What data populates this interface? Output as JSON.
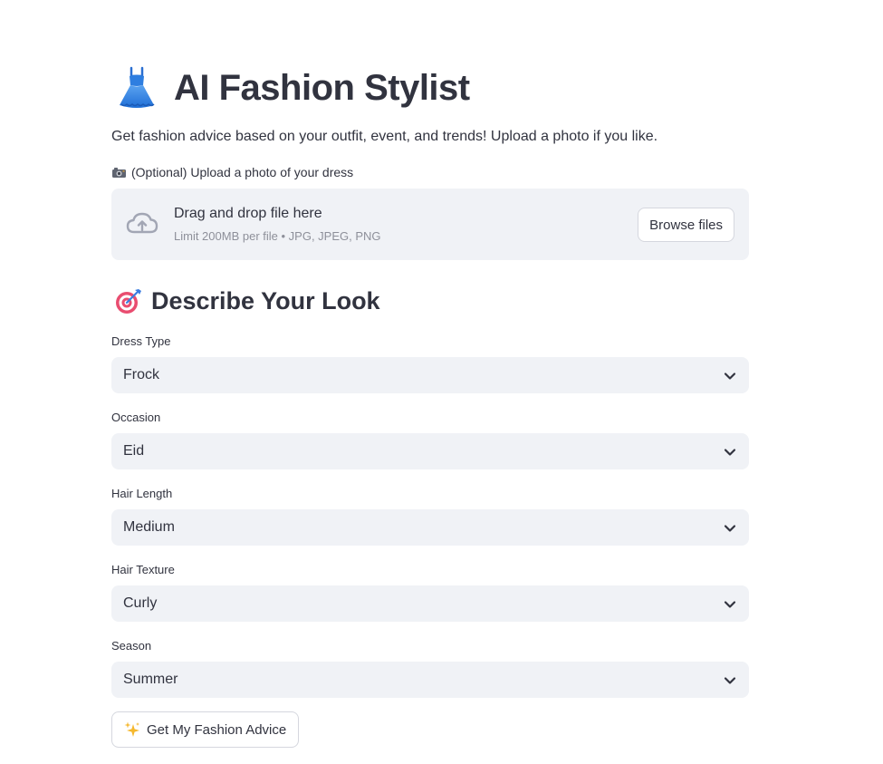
{
  "header": {
    "title": "AI Fashion Stylist",
    "title_icon": "dress-icon",
    "subtitle": "Get fashion advice based on your outfit, event, and trends! Upload a photo if you like."
  },
  "upload": {
    "label_icon": "camera-icon",
    "label": "(Optional) Upload a photo of your dress",
    "drop_text": "Drag and drop file here",
    "limit_text": "Limit 200MB per file • JPG, JPEG, PNG",
    "browse_label": "Browse files"
  },
  "section": {
    "icon": "target-icon",
    "heading": "Describe Your Look"
  },
  "fields": [
    {
      "label": "Dress Type",
      "value": "Frock"
    },
    {
      "label": "Occasion",
      "value": "Eid"
    },
    {
      "label": "Hair Length",
      "value": "Medium"
    },
    {
      "label": "Hair Texture",
      "value": "Curly"
    },
    {
      "label": "Season",
      "value": "Summer"
    }
  ],
  "submit": {
    "icon": "sparkles-icon",
    "label": "Get My Fashion Advice"
  },
  "colors": {
    "text": "#31333f",
    "input_bg": "#f0f2f6",
    "muted": "#8e909a",
    "border": "#d5d7de"
  }
}
